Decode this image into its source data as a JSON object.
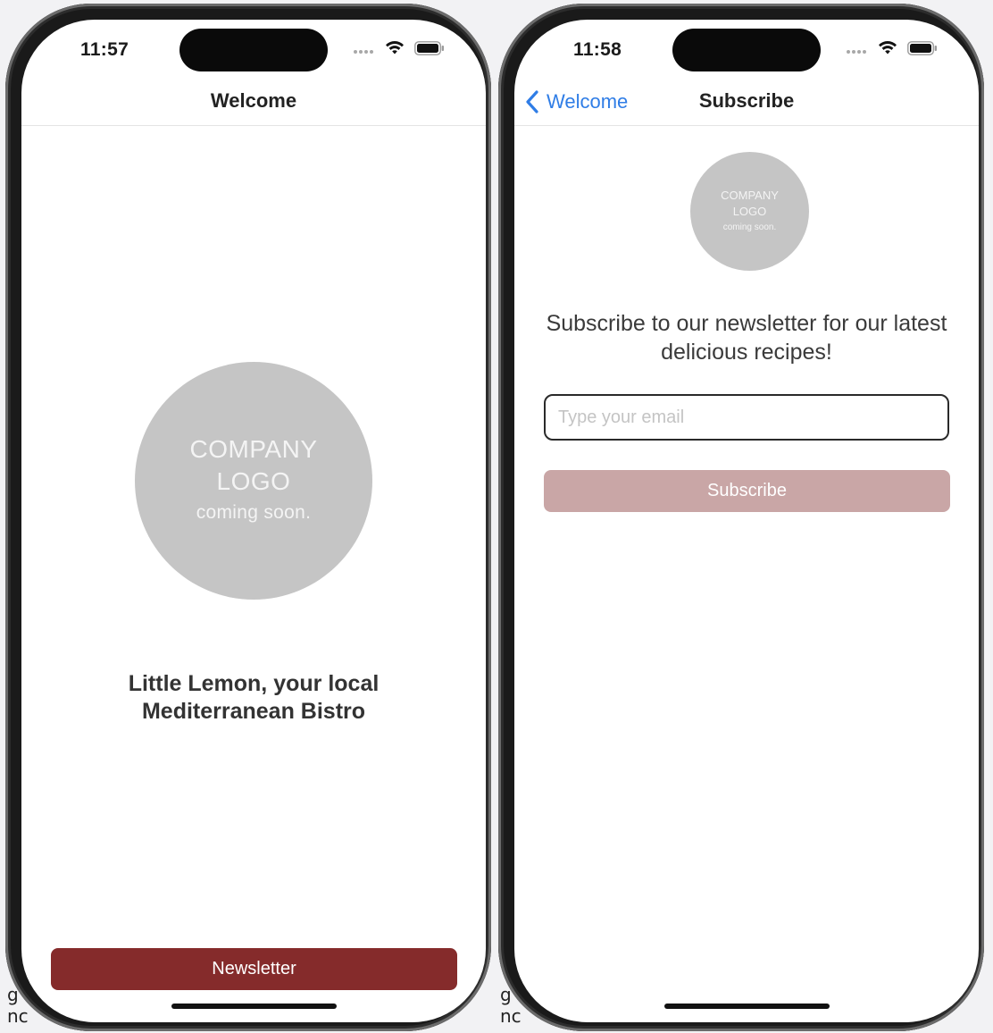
{
  "colors": {
    "accent_red": "#852b2b",
    "disabled_button": "#c9a6a6",
    "logo_gray": "#c5c5c5",
    "link_blue": "#2f7de6"
  },
  "welcome_screen": {
    "status_time": "11:57",
    "nav_title": "Welcome",
    "logo": {
      "line1": "COMPANY",
      "line2": "LOGO",
      "line3": "coming soon."
    },
    "tagline": "Little Lemon, your local Mediterranean Bistro",
    "newsletter_button": "Newsletter"
  },
  "subscribe_screen": {
    "status_time": "11:58",
    "back_label": "Welcome",
    "nav_title": "Subscribe",
    "logo": {
      "line1": "COMPANY",
      "line2": "LOGO",
      "line3": "coming soon."
    },
    "headline": "Subscribe to our newsletter for our latest delicious recipes!",
    "email_placeholder": "Type your email",
    "email_value": "",
    "subscribe_button": "Subscribe"
  },
  "edge_fragments": {
    "left_top": "g",
    "left_bottom": "nc",
    "right_top": "g",
    "right_bottom": "nc"
  },
  "icons": [
    "wifi-icon",
    "battery-icon",
    "cellular-signal-icon",
    "chevron-left-icon"
  ]
}
